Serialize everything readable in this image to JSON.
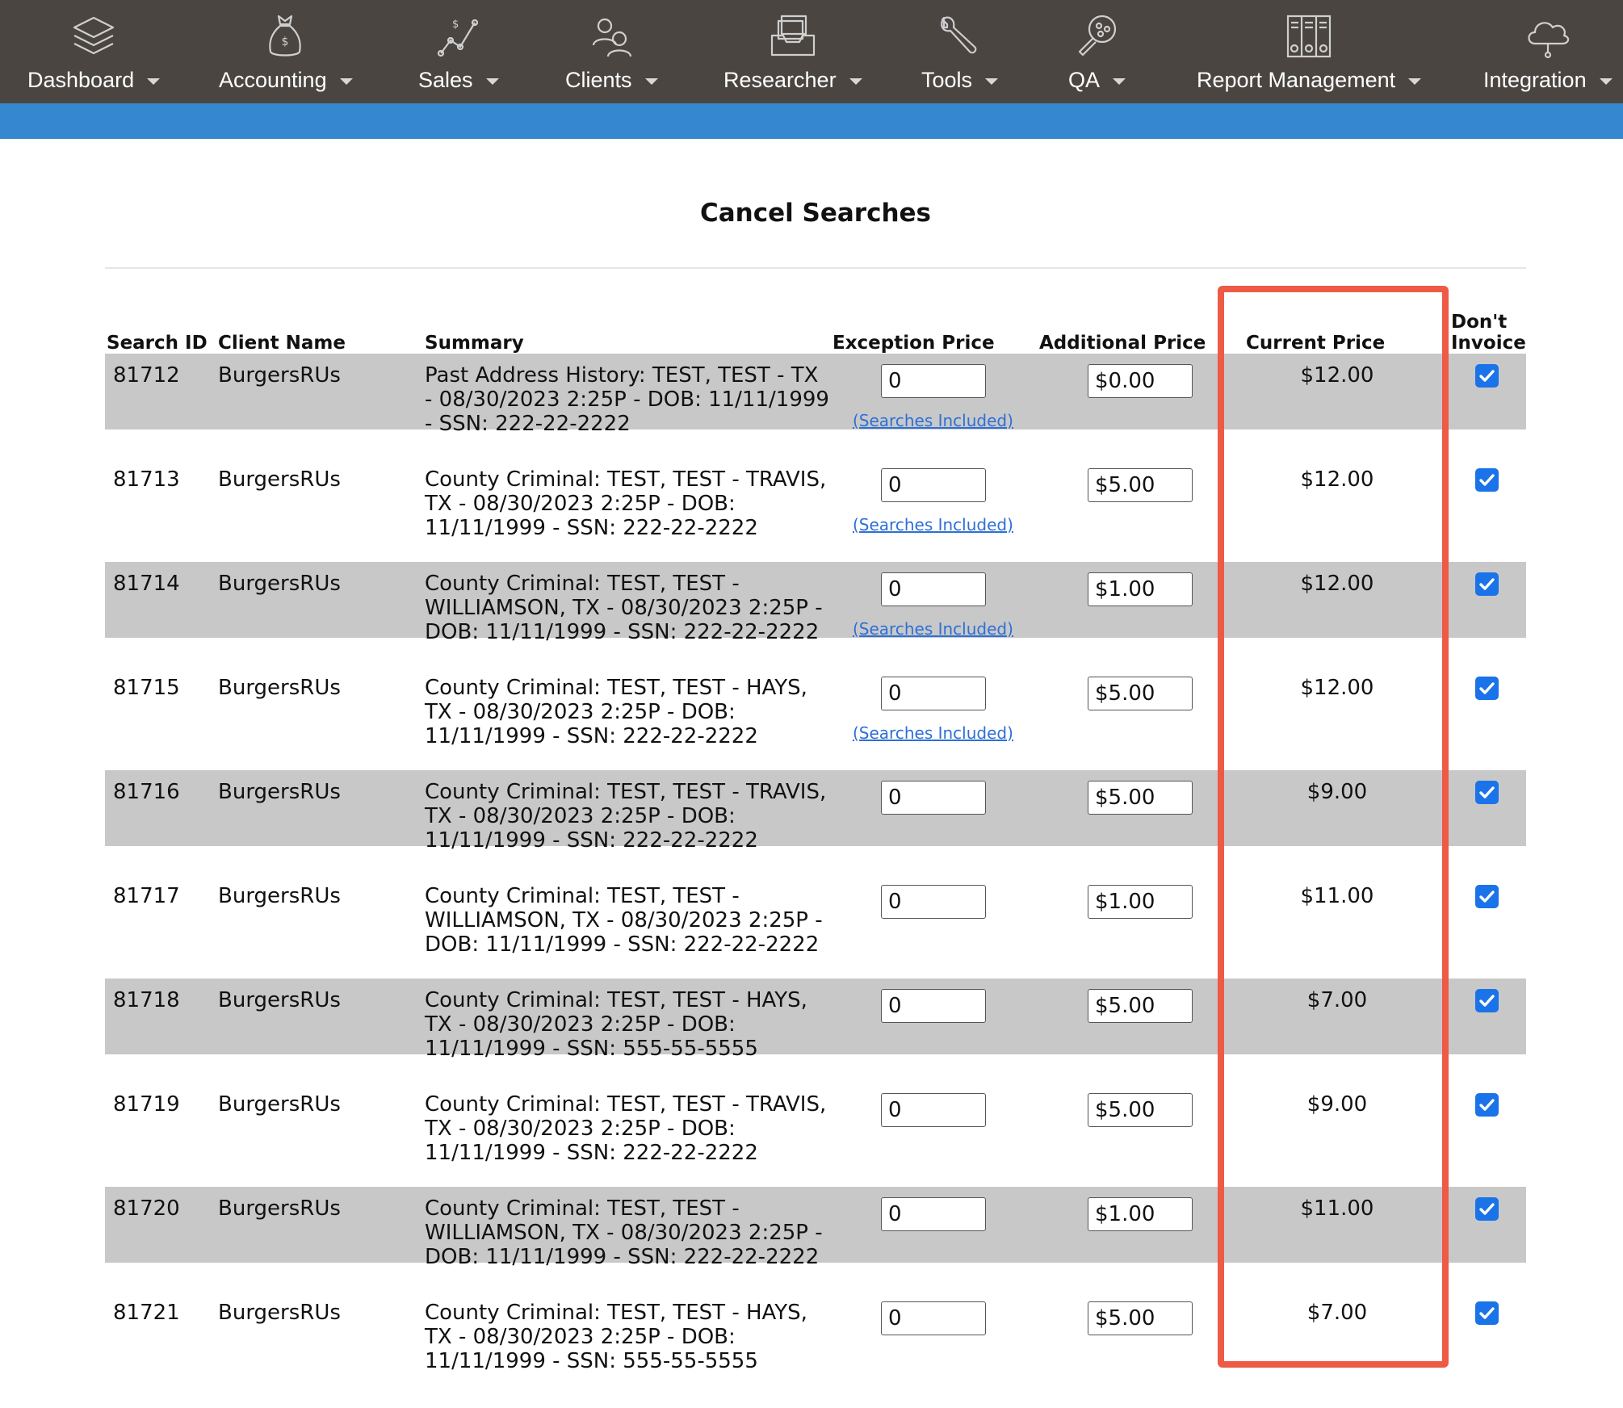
{
  "nav": {
    "items": [
      {
        "label": "Dashboard",
        "icon": "layers-icon"
      },
      {
        "label": "Accounting",
        "icon": "money-bag-icon"
      },
      {
        "label": "Sales",
        "icon": "sales-chart-icon"
      },
      {
        "label": "Clients",
        "icon": "users-icon"
      },
      {
        "label": "Researcher",
        "icon": "inbox-tray-icon"
      },
      {
        "label": "Tools",
        "icon": "wrench-icon"
      },
      {
        "label": "QA",
        "icon": "magnifier-icon"
      },
      {
        "label": "Report Management",
        "icon": "binders-icon"
      },
      {
        "label": "Integration",
        "icon": "cloud-icon"
      }
    ]
  },
  "page": {
    "title": "Cancel Searches"
  },
  "table": {
    "headers": {
      "search_id": "Search ID",
      "client_name": "Client Name",
      "summary": "Summary",
      "exception_price": "Exception Price",
      "additional_price": "Additional Price",
      "current_price": "Current Price",
      "dont_invoice_1": "Don't",
      "dont_invoice_2": "Invoice"
    },
    "link_label": "(Searches Included)",
    "rows": [
      {
        "id": "81712",
        "client": "BurgersRUs",
        "summary": "Past Address History: TEST, TEST - TX - 08/30/2023 2:25P - DOB: 11/11/1999 - SSN: 222-22-2222",
        "exception": "0",
        "additional": "$0.00",
        "current": "$12.00",
        "link": true,
        "dont_invoice": true
      },
      {
        "id": "81713",
        "client": "BurgersRUs",
        "summary": "County Criminal: TEST, TEST - TRAVIS, TX - 08/30/2023 2:25P - DOB: 11/11/1999 - SSN: 222-22-2222",
        "exception": "0",
        "additional": "$5.00",
        "current": "$12.00",
        "link": true,
        "dont_invoice": true
      },
      {
        "id": "81714",
        "client": "BurgersRUs",
        "summary": "County Criminal: TEST, TEST - WILLIAMSON, TX - 08/30/2023 2:25P - DOB: 11/11/1999 - SSN: 222-22-2222",
        "exception": "0",
        "additional": "$1.00",
        "current": "$12.00",
        "link": true,
        "dont_invoice": true
      },
      {
        "id": "81715",
        "client": "BurgersRUs",
        "summary": "County Criminal: TEST, TEST - HAYS, TX - 08/30/2023 2:25P - DOB: 11/11/1999 - SSN: 222-22-2222",
        "exception": "0",
        "additional": "$5.00",
        "current": "$12.00",
        "link": true,
        "dont_invoice": true
      },
      {
        "id": "81716",
        "client": "BurgersRUs",
        "summary": "County Criminal: TEST, TEST - TRAVIS, TX - 08/30/2023 2:25P - DOB: 11/11/1999 - SSN: 222-22-2222",
        "exception": "0",
        "additional": "$5.00",
        "current": "$9.00",
        "link": false,
        "dont_invoice": true
      },
      {
        "id": "81717",
        "client": "BurgersRUs",
        "summary": "County Criminal: TEST, TEST - WILLIAMSON, TX - 08/30/2023 2:25P - DOB: 11/11/1999 - SSN: 222-22-2222",
        "exception": "0",
        "additional": "$1.00",
        "current": "$11.00",
        "link": false,
        "dont_invoice": true
      },
      {
        "id": "81718",
        "client": "BurgersRUs",
        "summary": "County Criminal: TEST, TEST - HAYS, TX - 08/30/2023 2:25P - DOB: 11/11/1999 - SSN: 555-55-5555",
        "exception": "0",
        "additional": "$5.00",
        "current": "$7.00",
        "link": false,
        "dont_invoice": true
      },
      {
        "id": "81719",
        "client": "BurgersRUs",
        "summary": "County Criminal: TEST, TEST - TRAVIS, TX - 08/30/2023 2:25P - DOB: 11/11/1999 - SSN: 222-22-2222",
        "exception": "0",
        "additional": "$5.00",
        "current": "$9.00",
        "link": false,
        "dont_invoice": true
      },
      {
        "id": "81720",
        "client": "BurgersRUs",
        "summary": "County Criminal: TEST, TEST - WILLIAMSON, TX - 08/30/2023 2:25P - DOB: 11/11/1999 - SSN: 222-22-2222",
        "exception": "0",
        "additional": "$1.00",
        "current": "$11.00",
        "link": false,
        "dont_invoice": true
      },
      {
        "id": "81721",
        "client": "BurgersRUs",
        "summary": "County Criminal: TEST, TEST - HAYS, TX - 08/30/2023 2:25P - DOB: 11/11/1999 - SSN: 555-55-5555",
        "exception": "0",
        "additional": "$5.00",
        "current": "$7.00",
        "link": false,
        "dont_invoice": true
      }
    ]
  },
  "colors": {
    "nav_bg": "#4a4541",
    "accent_bar": "#3588d0",
    "row_shade": "#c8c8c8",
    "highlight": "#ee5a45",
    "checkbox": "#1a73e8",
    "link": "#2e6fd6"
  }
}
